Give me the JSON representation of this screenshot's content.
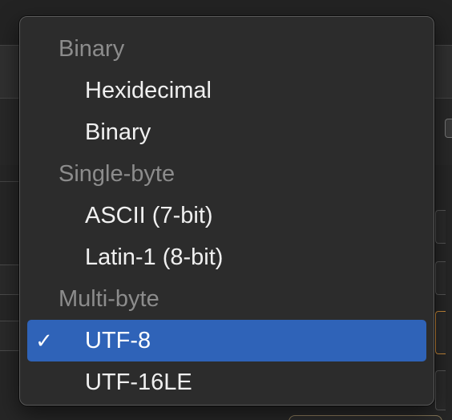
{
  "menu": {
    "sections": [
      {
        "header": "Binary",
        "items": [
          {
            "label": "Hexidecimal",
            "selected": false
          },
          {
            "label": "Binary",
            "selected": false
          }
        ]
      },
      {
        "header": "Single-byte",
        "items": [
          {
            "label": "ASCII (7-bit)",
            "selected": false
          },
          {
            "label": "Latin-1 (8-bit)",
            "selected": false
          }
        ]
      },
      {
        "header": "Multi-byte",
        "items": [
          {
            "label": "UTF-8",
            "selected": true
          },
          {
            "label": "UTF-16LE",
            "selected": false
          }
        ]
      }
    ],
    "checkmark": "✓"
  },
  "colors": {
    "selection": "#2f63b8",
    "header_text": "#8c8c8c",
    "item_text": "#f0f0f0",
    "focus_ring": "#c88a3a"
  }
}
